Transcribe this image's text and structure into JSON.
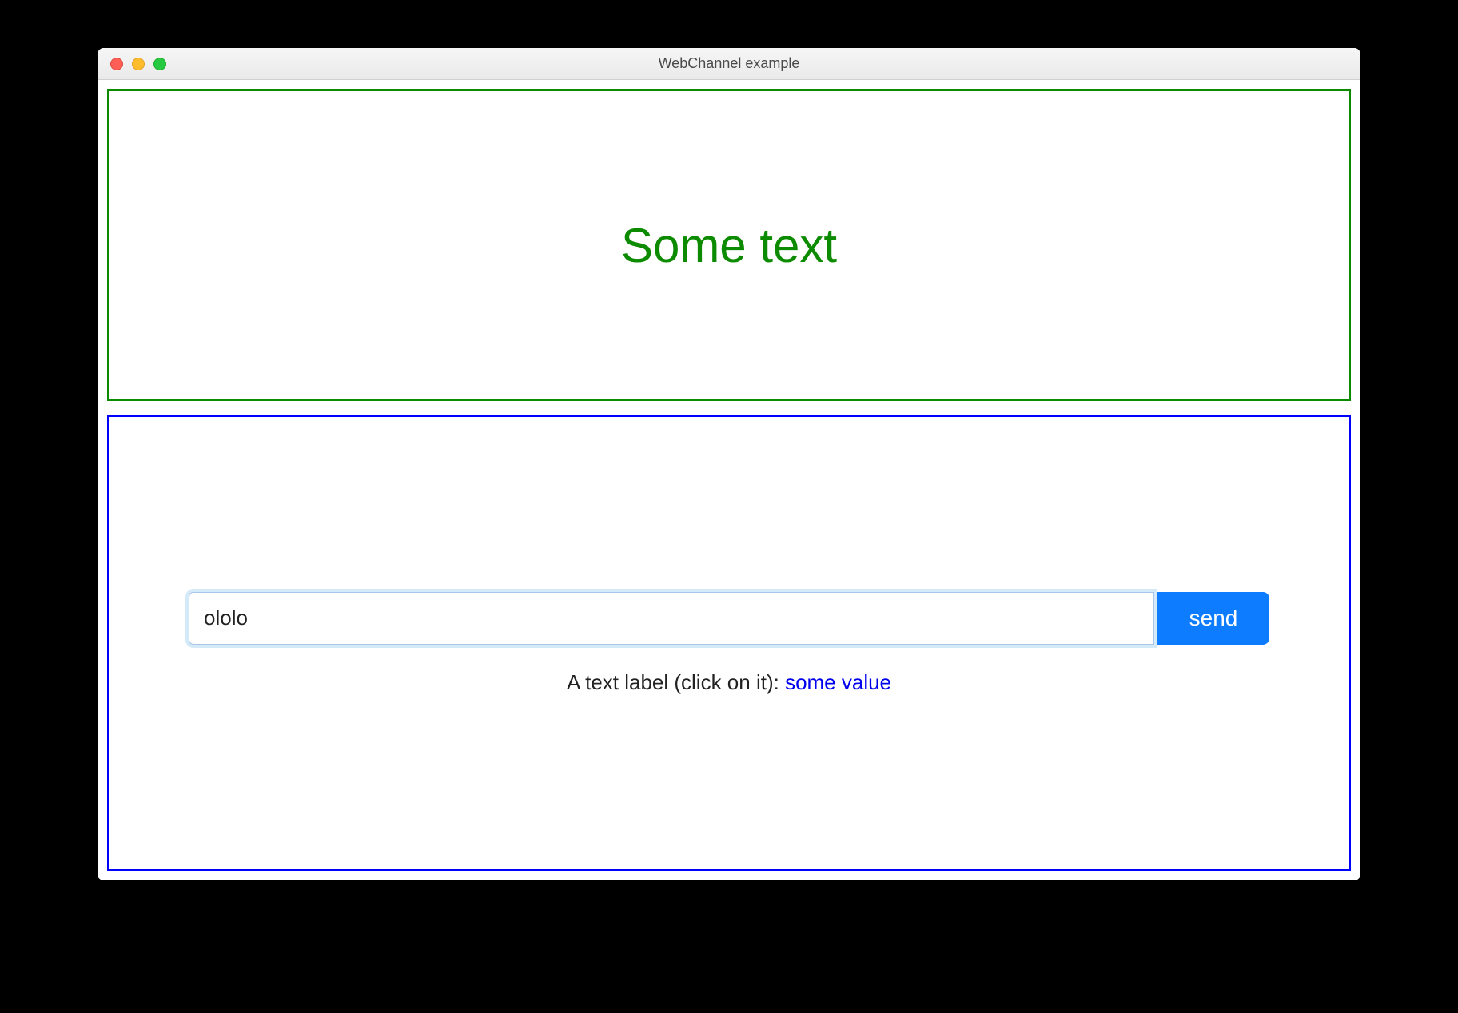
{
  "window": {
    "title": "WebChannel example"
  },
  "topPanel": {
    "heading": "Some text"
  },
  "bottomPanel": {
    "input": {
      "value": "ololo",
      "placeholder": ""
    },
    "sendButton": {
      "label": "send"
    },
    "labelRow": {
      "prefix": "A text label (click on it): ",
      "linkText": "some value"
    }
  },
  "colors": {
    "green": "#0c8b00",
    "blue": "#0000ff",
    "buttonBlue": "#0d7cff",
    "linkBlue": "#0000ee"
  }
}
